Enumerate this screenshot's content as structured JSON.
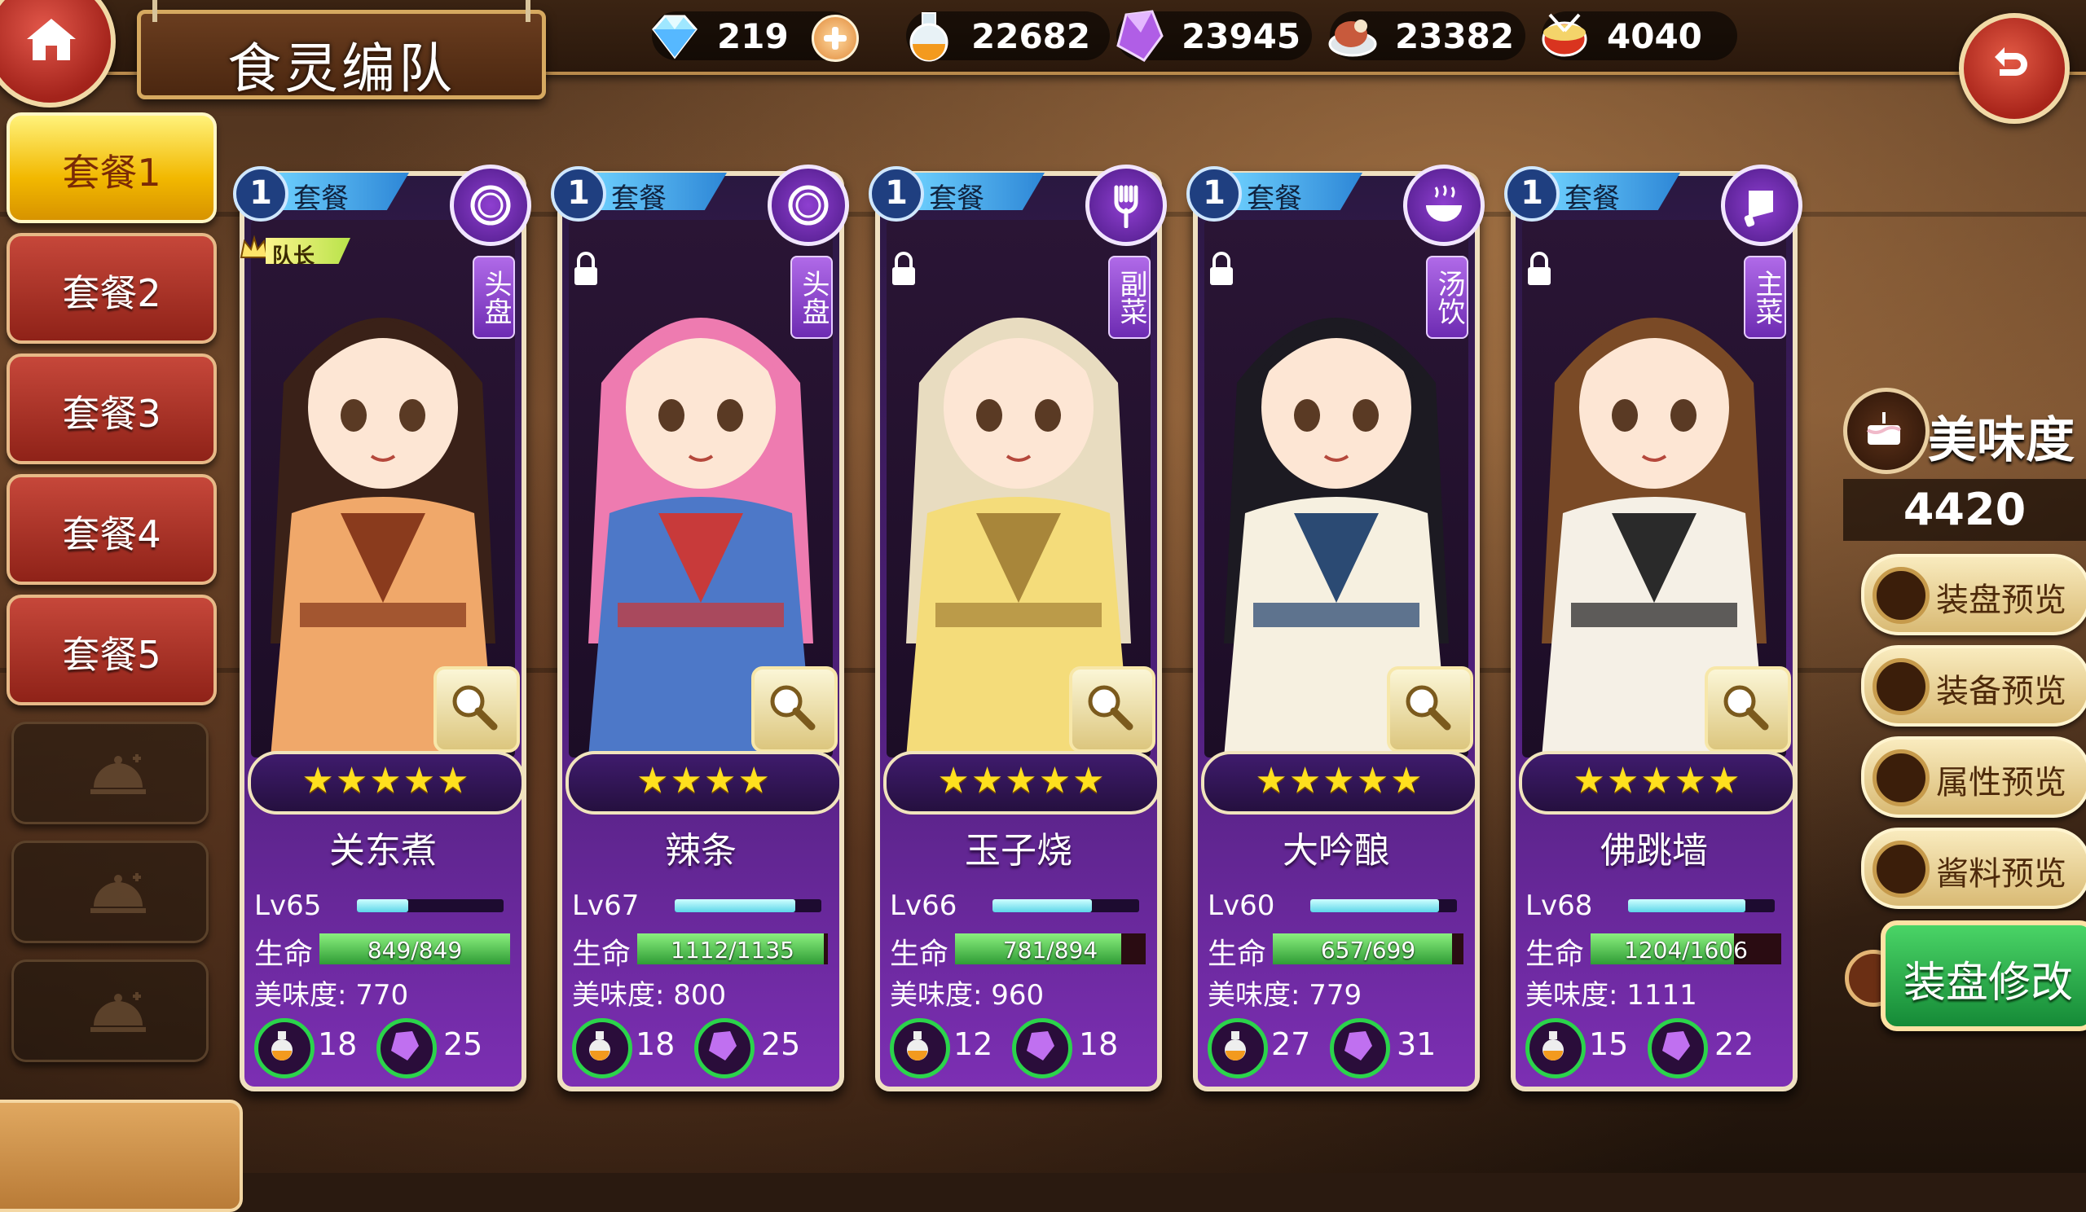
{
  "title": "食灵编队",
  "resources": [
    {
      "icon": "diamond-icon",
      "value": "219",
      "has_plus": true
    },
    {
      "icon": "potion-flask-icon",
      "value": "22682"
    },
    {
      "icon": "purple-crystal-icon",
      "value": "23945"
    },
    {
      "icon": "meat-plate-icon",
      "value": "23382"
    },
    {
      "icon": "drum-icon",
      "value": "4040"
    }
  ],
  "sidebar": {
    "sets": [
      {
        "label": "套餐1",
        "active": true
      },
      {
        "label": "套餐2"
      },
      {
        "label": "套餐3"
      },
      {
        "label": "套餐4"
      },
      {
        "label": "套餐5"
      }
    ],
    "empty_slots": 3
  },
  "cards": [
    {
      "num": "1",
      "tag": "套餐",
      "category_icon": "plate-icon",
      "role": "头盘",
      "captain": true,
      "captain_label": "队长",
      "locked": false,
      "stars": "★★★★★",
      "star_count": 5,
      "name": "关东煮",
      "level": "Lv65",
      "xp": 0.35,
      "hp_label": "生命",
      "hp_text": "849/849",
      "hp": 1.0,
      "taste_text": "美味度: 770",
      "stat1": "18",
      "stat2": "25",
      "art": {
        "c1": "#f0a86a",
        "c2": "#8a3b1d",
        "hair": "#3a2118"
      }
    },
    {
      "num": "1",
      "tag": "套餐",
      "category_icon": "plate-icon",
      "role": "头盘",
      "captain": false,
      "locked": true,
      "stars": "★★★★",
      "star_count": 4,
      "name": "辣条",
      "level": "Lv67",
      "xp": 0.82,
      "hp_label": "生命",
      "hp_text": "1112/1135",
      "hp": 0.98,
      "taste_text": "美味度: 800",
      "stat1": "18",
      "stat2": "25",
      "art": {
        "c1": "#4d78c8",
        "c2": "#c83a3a",
        "hair": "#ee7bb0"
      }
    },
    {
      "num": "1",
      "tag": "套餐",
      "category_icon": "fork-icon",
      "role": "副菜",
      "captain": false,
      "locked": true,
      "stars": "★★★★★",
      "star_count": 5,
      "name": "玉子烧",
      "level": "Lv66",
      "xp": 0.68,
      "hp_label": "生命",
      "hp_text": "781/894",
      "hp": 0.87,
      "taste_text": "美味度: 960",
      "stat1": "12",
      "stat2": "18",
      "art": {
        "c1": "#f4dc7a",
        "c2": "#a8863a",
        "hair": "#e8dcc0"
      }
    },
    {
      "num": "1",
      "tag": "套餐",
      "category_icon": "soup-bowl-icon",
      "role": "汤饮",
      "captain": false,
      "locked": true,
      "stars": "★★★★★",
      "star_count": 5,
      "name": "大吟酿",
      "level": "Lv60",
      "xp": 0.88,
      "hp_label": "生命",
      "hp_text": "657/699",
      "hp": 0.94,
      "taste_text": "美味度: 779",
      "stat1": "27",
      "stat2": "31",
      "art": {
        "c1": "#f6f0e0",
        "c2": "#2b4a73",
        "hair": "#1c1a22"
      }
    },
    {
      "num": "1",
      "tag": "套餐",
      "category_icon": "cleaver-icon",
      "role": "主菜",
      "captain": false,
      "locked": true,
      "stars": "★★★★★",
      "star_count": 5,
      "name": "佛跳墙",
      "level": "Lv68",
      "xp": 0.8,
      "hp_label": "生命",
      "hp_text": "1204/1606",
      "hp": 0.75,
      "taste_text": "美味度: 1111",
      "stat1": "15",
      "stat2": "22",
      "art": {
        "c1": "#f5f0e6",
        "c2": "#2a2a2a",
        "hair": "#7a4a26"
      }
    }
  ],
  "panel": {
    "title": "美味度",
    "score": "4420",
    "previews": [
      "装盘预览",
      "装备预览",
      "属性预览",
      "酱料预览"
    ],
    "edit_label": "装盘修改"
  }
}
